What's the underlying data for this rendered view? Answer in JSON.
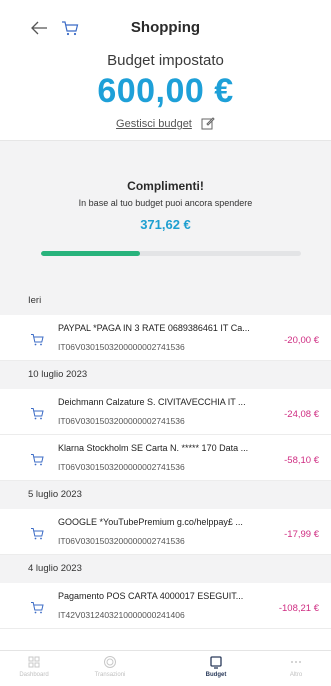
{
  "header": {
    "title": "Shopping",
    "budget_label": "Budget impostato",
    "budget_amount": "600,00 €",
    "manage_label": "Gestisci budget"
  },
  "summary": {
    "title": "Complimenti!",
    "subtitle": "In base al tuo budget puoi ancora spendere",
    "remaining": "371,62 €",
    "progress_fraction": 0.38,
    "progress_color": "#28b37c"
  },
  "sections": [
    {
      "date": "Ieri",
      "transactions": [
        {
          "description": "PAYPAL *PAGA IN 3 RATE 0689386461 IT Ca...",
          "iban": "IT06V0301503200000002741536",
          "amount": "-20,00 €"
        }
      ]
    },
    {
      "date": "10 luglio 2023",
      "transactions": [
        {
          "description": "Deichmann Calzature S. CIVITAVECCHIA IT ...",
          "iban": "IT06V0301503200000002741536",
          "amount": "-24,08 €"
        },
        {
          "description": "Klarna Stockholm SE Carta N. ***** 170 Data ...",
          "iban": "IT06V0301503200000002741536",
          "amount": "-58,10 €"
        }
      ]
    },
    {
      "date": "5 luglio 2023",
      "transactions": [
        {
          "description": "GOOGLE *YouTubePremium g.co/helppay£ ...",
          "iban": "IT06V0301503200000002741536",
          "amount": "-17,99 €"
        }
      ]
    },
    {
      "date": "4 luglio 2023",
      "transactions": [
        {
          "description": "Pagamento POS CARTA 4000017 ESEGUIT...",
          "iban": "IT42V0312403210000000241406",
          "amount": "-108,21 €"
        }
      ]
    }
  ],
  "nav": {
    "items": [
      {
        "label": "Dashboard",
        "icon": "grid-icon"
      },
      {
        "label": "Transazioni",
        "icon": "coin-icon"
      },
      {
        "label": "Budget",
        "icon": "budget-icon"
      },
      {
        "label": "Altro",
        "icon": "more-icon"
      }
    ]
  },
  "colors": {
    "accent": "#1ea0d8",
    "negative_amount": "#cf2c82",
    "progress": "#28b37c"
  }
}
